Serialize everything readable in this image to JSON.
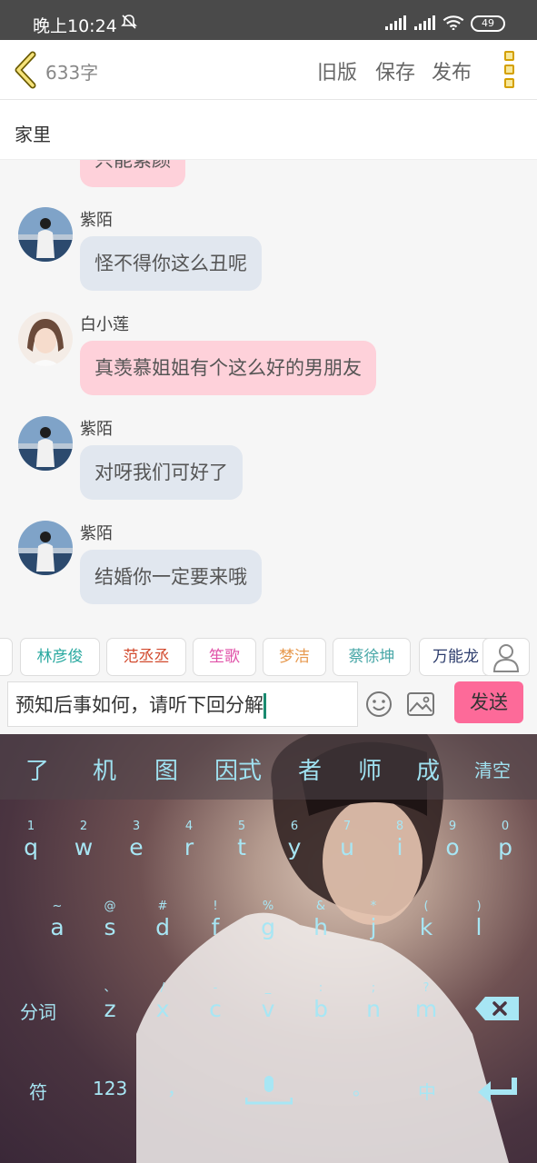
{
  "status": {
    "time": "晚上10:24",
    "battery": "49"
  },
  "header": {
    "word_count": "633字",
    "old_version": "旧版",
    "save": "保存",
    "publish": "发布"
  },
  "location": "家里",
  "messages": [
    {
      "name": "",
      "text": "只能素颜",
      "style": "pink"
    },
    {
      "name": "紫陌",
      "text": "怪不得你这么丑呢",
      "style": "gray"
    },
    {
      "name": "白小莲",
      "text": "真羡慕姐姐有个这么好的男朋友",
      "style": "pink"
    },
    {
      "name": "紫陌",
      "text": "对呀我们可好了",
      "style": "gray"
    },
    {
      "name": "紫陌",
      "text": "结婚你一定要来哦",
      "style": "gray"
    }
  ],
  "roles": [
    {
      "label": "林彦俊",
      "color": "#2aa9a0"
    },
    {
      "label": "范丞丞",
      "color": "#d24a2e"
    },
    {
      "label": "笙歌",
      "color": "#e052a8"
    },
    {
      "label": "梦洁",
      "color": "#e79a50"
    },
    {
      "label": "蔡徐坤",
      "color": "#4aa8a8"
    },
    {
      "label": "万能龙",
      "color": "#2c3c6c"
    }
  ],
  "input": {
    "value": "预知后事如何，请听下回分解",
    "send": "发送"
  },
  "keyboard": {
    "candidates": [
      "了",
      "机",
      "图",
      "因式",
      "者",
      "师",
      "成"
    ],
    "clear": "清空",
    "row1": [
      [
        "1",
        "q"
      ],
      [
        "2",
        "w"
      ],
      [
        "3",
        "e"
      ],
      [
        "4",
        "r"
      ],
      [
        "5",
        "t"
      ],
      [
        "6",
        "y"
      ],
      [
        "7",
        "u"
      ],
      [
        "8",
        "i"
      ],
      [
        "9",
        "o"
      ],
      [
        "0",
        "p"
      ]
    ],
    "row2": [
      [
        "~",
        "a"
      ],
      [
        "@",
        "s"
      ],
      [
        "#",
        "d"
      ],
      [
        "!",
        "f"
      ],
      [
        "%",
        "g"
      ],
      [
        "&",
        "h"
      ],
      [
        "*",
        "j"
      ],
      [
        "(",
        "k"
      ],
      [
        ")",
        "l"
      ]
    ],
    "row3": [
      [
        "、",
        "z"
      ],
      [
        "/",
        "x"
      ],
      [
        "-",
        "c"
      ],
      [
        "_",
        "v"
      ],
      [
        ":",
        "b"
      ],
      [
        ";",
        "n"
      ],
      [
        "?",
        "m"
      ]
    ],
    "fenci": "分词",
    "fu": "符",
    "num": "123",
    "comma": "，",
    "period": "。",
    "zh": "中"
  }
}
